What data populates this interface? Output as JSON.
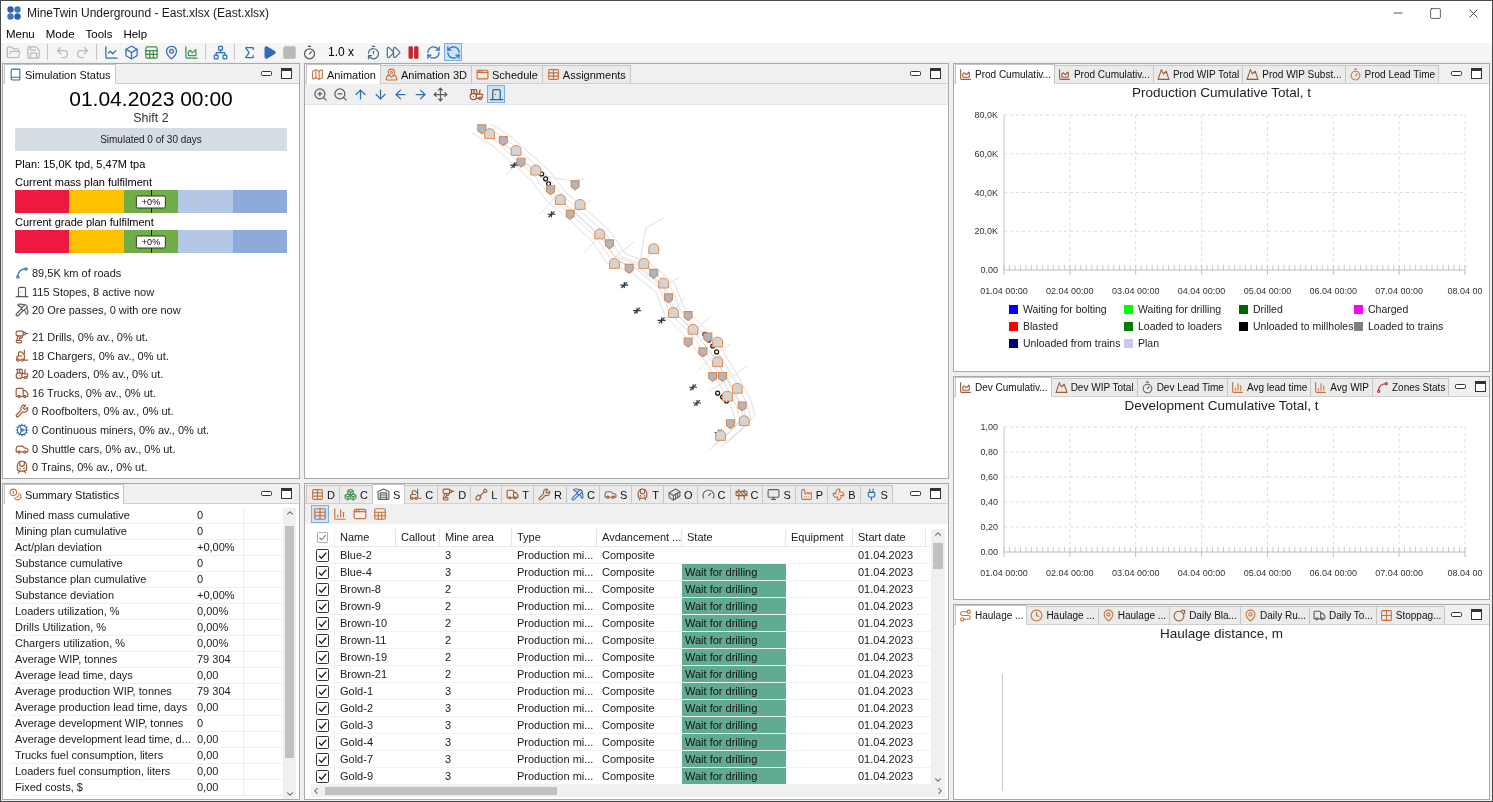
{
  "window": {
    "title": "MineTwin Underground - East.xlsx (East.xlsx)"
  },
  "menu": [
    "Menu",
    "Mode",
    "Tools",
    "Help"
  ],
  "toolbar": [
    {
      "kind": "button",
      "disabled": true,
      "pressed": false
    },
    {
      "kind": "button",
      "disabled": true,
      "pressed": false
    },
    {
      "kind": "separator"
    },
    {
      "kind": "button",
      "disabled": true,
      "pressed": false
    },
    {
      "kind": "button",
      "disabled": true,
      "pressed": false
    },
    {
      "kind": "separator"
    },
    {
      "kind": "button",
      "disabled": false,
      "pressed": false
    },
    {
      "kind": "button",
      "disabled": false,
      "pressed": false
    },
    {
      "kind": "button",
      "disabled": false,
      "pressed": false
    },
    {
      "kind": "button",
      "disabled": false,
      "pressed": false
    },
    {
      "kind": "button",
      "disabled": false,
      "pressed": false
    },
    {
      "kind": "separator"
    },
    {
      "kind": "button",
      "disabled": false,
      "pressed": false
    },
    {
      "kind": "separator"
    },
    {
      "kind": "button",
      "disabled": false,
      "pressed": false
    },
    {
      "kind": "button",
      "disabled": false,
      "pressed": false
    },
    {
      "kind": "button",
      "disabled": true,
      "pressed": false
    },
    {
      "kind": "button",
      "disabled": false,
      "pressed": false
    },
    {
      "kind": "label",
      "text": "1.0 x"
    },
    {
      "kind": "button",
      "disabled": false,
      "pressed": false
    },
    {
      "kind": "button",
      "disabled": false,
      "pressed": false
    },
    {
      "kind": "button",
      "disabled": false,
      "pressed": false
    },
    {
      "kind": "button",
      "disabled": false,
      "pressed": false
    },
    {
      "kind": "button",
      "disabled": false,
      "pressed": true
    }
  ],
  "simulation_status": {
    "tab": "Simulation Status",
    "datetime": "01.04.2023 00:00",
    "shift": "Shift 2",
    "progress": "Simulated 0 of 30 days",
    "plan": "Plan: 15,0K tpd, 5,47M tpa",
    "gauges": [
      {
        "label": "Current mass plan fulfilment",
        "value": "+0%",
        "level": 0.5
      },
      {
        "label": "Current grade plan fulfilment",
        "value": "+0%",
        "level": 0.5
      }
    ],
    "infrastructure": [
      "89,5K km of roads",
      "115 Stopes, 8 active now",
      "20 Ore passes, 0 with ore now"
    ],
    "equipment": [
      "21 Drills, 0% av., 0% ut.",
      "18 Chargers, 0% av., 0% ut.",
      "20 Loaders, 0% av., 0% ut.",
      "16 Trucks, 0% av., 0% ut.",
      "0 Roofbolters, 0% av., 0% ut.",
      "0 Continuous miners, 0% av., 0% ut.",
      "0 Shuttle cars, 0% av., 0% ut.",
      "0 Trains, 0% av., 0% ut."
    ]
  },
  "summary_statistics": {
    "tab": "Summary Statistics",
    "rows": [
      {
        "label": "Mined mass cumulative",
        "value": "0"
      },
      {
        "label": "Mining plan cumulative",
        "value": "0"
      },
      {
        "label": "Act/plan deviation",
        "value": "+0,00%"
      },
      {
        "label": "Substance cumulative",
        "value": "0"
      },
      {
        "label": "Substance plan cumulative",
        "value": "0"
      },
      {
        "label": "Substance deviation",
        "value": "+0,00%"
      },
      {
        "label": "Loaders utilization, %",
        "value": "0,00%"
      },
      {
        "label": "Drills Utilization, %",
        "value": "0,00%"
      },
      {
        "label": "Chargers utilization, %",
        "value": "0,00%"
      },
      {
        "label": "Average WIP, tonnes",
        "value": "79 304"
      },
      {
        "label": "Average lead time, days",
        "value": "0,00"
      },
      {
        "label": "Average production WIP, tonnes",
        "value": "79 304"
      },
      {
        "label": "Average production lead time, days",
        "value": "0,00"
      },
      {
        "label": "Average development WIP, tonnes",
        "value": "0"
      },
      {
        "label": "Average development lead time, d...",
        "value": "0,00"
      },
      {
        "label": "Trucks fuel consumption, liters",
        "value": "0,00"
      },
      {
        "label": "Loaders fuel consumption, liters",
        "value": "0,00"
      },
      {
        "label": "Fixed costs, $",
        "value": "0,00"
      }
    ]
  },
  "animation": {
    "tabs": [
      {
        "label": "Animation",
        "selected": true
      },
      {
        "label": "Animation 3D",
        "selected": false
      },
      {
        "label": "Schedule",
        "selected": false
      },
      {
        "label": "Assignments",
        "selected": false
      }
    ],
    "tools": [
      {
        "pressed": false
      },
      {
        "pressed": false
      },
      {
        "pressed": false
      },
      {
        "pressed": false
      },
      {
        "pressed": false
      },
      {
        "pressed": false
      },
      {
        "pressed": false
      },
      {
        "pressed": false
      },
      {
        "pressed": true
      }
    ]
  },
  "objects_table": {
    "tabs": [
      {
        "label": "D",
        "selected": false
      },
      {
        "label": "C",
        "selected": false
      },
      {
        "label": "S",
        "selected": true
      },
      {
        "label": "C",
        "selected": false
      },
      {
        "label": "D",
        "selected": false
      },
      {
        "label": "L",
        "selected": false
      },
      {
        "label": "T",
        "selected": false
      },
      {
        "label": "R",
        "selected": false
      },
      {
        "label": "C",
        "selected": false
      },
      {
        "label": "S",
        "selected": false
      },
      {
        "label": "T",
        "selected": false
      },
      {
        "label": "O",
        "selected": false
      },
      {
        "label": "C",
        "selected": false
      },
      {
        "label": "C",
        "selected": false
      },
      {
        "label": "S",
        "selected": false
      },
      {
        "label": "P",
        "selected": false
      },
      {
        "label": "B",
        "selected": false
      },
      {
        "label": "S",
        "selected": false
      }
    ],
    "views": [
      {
        "selected": true
      },
      {
        "selected": false
      },
      {
        "selected": false
      },
      {
        "selected": false
      }
    ],
    "all_checked": true,
    "columns": [
      "Name",
      "Callout",
      "Mine area",
      "Type",
      "Avdancement ...",
      "State",
      "Equipment",
      "Start date"
    ],
    "rows": [
      {
        "checked": true,
        "name": "Blue-2",
        "mine_area": "3",
        "type": "Production mi...",
        "advancement": "Composite",
        "start_date": "01.04.2023"
      },
      {
        "checked": true,
        "name": "Blue-4",
        "mine_area": "3",
        "type": "Production mi...",
        "advancement": "Composite",
        "state": "Wait for drilling",
        "start_date": "01.04.2023"
      },
      {
        "checked": true,
        "name": "Brown-8",
        "mine_area": "2",
        "type": "Production mi...",
        "advancement": "Composite",
        "state": "Wait for drilling",
        "start_date": "01.04.2023"
      },
      {
        "checked": true,
        "name": "Brown-9",
        "mine_area": "2",
        "type": "Production mi...",
        "advancement": "Composite",
        "state": "Wait for drilling",
        "start_date": "01.04.2023"
      },
      {
        "checked": true,
        "name": "Brown-10",
        "mine_area": "2",
        "type": "Production mi...",
        "advancement": "Composite",
        "state": "Wait for drilling",
        "start_date": "01.04.2023"
      },
      {
        "checked": true,
        "name": "Brown-11",
        "mine_area": "2",
        "type": "Production mi...",
        "advancement": "Composite",
        "state": "Wait for drilling",
        "start_date": "01.04.2023"
      },
      {
        "checked": true,
        "name": "Brown-19",
        "mine_area": "2",
        "type": "Production mi...",
        "advancement": "Composite",
        "state": "Wait for drilling",
        "start_date": "01.04.2023"
      },
      {
        "checked": true,
        "name": "Brown-21",
        "mine_area": "2",
        "type": "Production mi...",
        "advancement": "Composite",
        "state": "Wait for drilling",
        "start_date": "01.04.2023"
      },
      {
        "checked": true,
        "name": "Gold-1",
        "mine_area": "3",
        "type": "Production mi...",
        "advancement": "Composite",
        "state": "Wait for drilling",
        "start_date": "01.04.2023"
      },
      {
        "checked": true,
        "name": "Gold-2",
        "mine_area": "3",
        "type": "Production mi...",
        "advancement": "Composite",
        "state": "Wait for drilling",
        "start_date": "01.04.2023"
      },
      {
        "checked": true,
        "name": "Gold-3",
        "mine_area": "3",
        "type": "Production mi...",
        "advancement": "Composite",
        "state": "Wait for drilling",
        "start_date": "01.04.2023"
      },
      {
        "checked": true,
        "name": "Gold-4",
        "mine_area": "3",
        "type": "Production mi...",
        "advancement": "Composite",
        "state": "Wait for drilling",
        "start_date": "01.04.2023"
      },
      {
        "checked": true,
        "name": "Gold-7",
        "mine_area": "3",
        "type": "Production mi...",
        "advancement": "Composite",
        "state": "Wait for drilling",
        "start_date": "01.04.2023"
      },
      {
        "checked": true,
        "name": "Gold-9",
        "mine_area": "3",
        "type": "Production mi...",
        "advancement": "Composite",
        "state": "Wait for drilling",
        "start_date": "01.04.2023"
      }
    ]
  },
  "production_chart": {
    "tabs": [
      {
        "label": "Prod Cumulativ...",
        "selected": true
      },
      {
        "label": "Prod Cumulativ...",
        "selected": false
      },
      {
        "label": "Prod WIP Total",
        "selected": false
      },
      {
        "label": "Prod WIP Subst...",
        "selected": false
      },
      {
        "label": "Prod Lead Time",
        "selected": false
      }
    ],
    "chart_data": {
      "type": "line",
      "title": "Production Cumulative Total, t",
      "categories": [
        "01.04 00:00",
        "02.04 00:00",
        "03.04 00:00",
        "04.04 00:00",
        "05.04 00:00",
        "06.04 00:00",
        "07.04 00:00",
        "08.04 00"
      ],
      "ylim": [
        0,
        80000
      ],
      "yticks": [
        {
          "value": 0,
          "label": "0.00"
        },
        {
          "value": 20000,
          "label": "20,0K"
        },
        {
          "value": 40000,
          "label": "40,0K"
        },
        {
          "value": 60000,
          "label": "60,0K"
        },
        {
          "value": 80000,
          "label": "80,0K"
        }
      ],
      "grid": true,
      "series": [
        {
          "name": "Waiting for bolting",
          "color": "#0000ff",
          "values": [
            null,
            null,
            null,
            null,
            null,
            null,
            null,
            null
          ]
        },
        {
          "name": "Waiting for drilling",
          "color": "#00ff00",
          "values": [
            null,
            null,
            null,
            null,
            null,
            null,
            null,
            null
          ]
        },
        {
          "name": "Drilled",
          "color": "#006400",
          "values": [
            null,
            null,
            null,
            null,
            null,
            null,
            null,
            null
          ]
        },
        {
          "name": "Charged",
          "color": "#ff00ff",
          "values": [
            null,
            null,
            null,
            null,
            null,
            null,
            null,
            null
          ]
        },
        {
          "name": "Blasted",
          "color": "#ff0000",
          "values": [
            null,
            null,
            null,
            null,
            null,
            null,
            null,
            null
          ]
        },
        {
          "name": "Loaded to loaders",
          "color": "#008000",
          "values": [
            null,
            null,
            null,
            null,
            null,
            null,
            null,
            null
          ]
        },
        {
          "name": "Unloaded to millholes",
          "color": "#000000",
          "values": [
            null,
            null,
            null,
            null,
            null,
            null,
            null,
            null
          ]
        },
        {
          "name": "Loaded to trains",
          "color": "#808080",
          "values": [
            null,
            null,
            null,
            null,
            null,
            null,
            null,
            null
          ]
        },
        {
          "name": "Unloaded from trains",
          "color": "#000080",
          "values": [
            null,
            null,
            null,
            null,
            null,
            null,
            null,
            null
          ]
        },
        {
          "name": "Plan",
          "color": "#c8c8f0",
          "values": [
            null,
            null,
            null,
            null,
            null,
            null,
            null,
            null
          ]
        }
      ]
    }
  },
  "development_chart": {
    "tabs": [
      {
        "label": "Dev Cumulativ...",
        "selected": true
      },
      {
        "label": "Dev WIP Total",
        "selected": false
      },
      {
        "label": "Dev Lead Time",
        "selected": false
      },
      {
        "label": "Avg lead time",
        "selected": false
      },
      {
        "label": "Avg WIP",
        "selected": false
      },
      {
        "label": "Zones Stats",
        "selected": false
      }
    ],
    "chart_data": {
      "type": "line",
      "title": "Development Cumulative Total, t",
      "categories": [
        "01.04 00:00",
        "02.04 00:00",
        "03.04 00:00",
        "04.04 00:00",
        "05.04 00:00",
        "06.04 00:00",
        "07.04 00:00",
        "08.04 00"
      ],
      "ylim": [
        0,
        1
      ],
      "yticks": [
        {
          "value": 0,
          "label": "0.00"
        },
        {
          "value": 0.2,
          "label": "0,20"
        },
        {
          "value": 0.4,
          "label": "0,40"
        },
        {
          "value": 0.6,
          "label": "0,60"
        },
        {
          "value": 0.8,
          "label": "0,80"
        },
        {
          "value": 1,
          "label": "1,00"
        }
      ],
      "grid": true
    }
  },
  "haulage_chart": {
    "tabs": [
      {
        "label": "Haulage ...",
        "selected": true
      },
      {
        "label": "Haulage ...",
        "selected": false
      },
      {
        "label": "Haulage ...",
        "selected": false
      },
      {
        "label": "Daily Bla...",
        "selected": false
      },
      {
        "label": "Daily Ru...",
        "selected": false
      },
      {
        "label": "Daily To...",
        "selected": false
      },
      {
        "label": "Stoppag...",
        "selected": false
      }
    ],
    "title": "Haulage distance, m"
  }
}
